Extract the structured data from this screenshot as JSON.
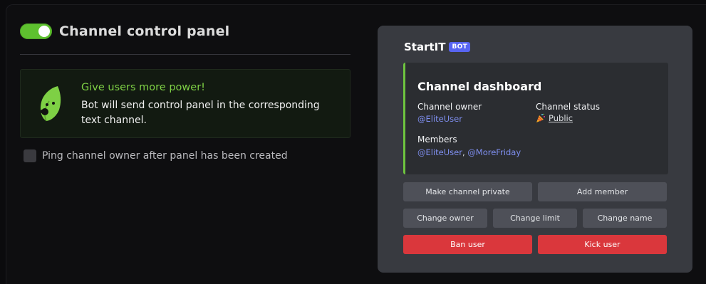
{
  "panel": {
    "title": "Channel control panel",
    "toggle_enabled": true,
    "info": {
      "heading": "Give users more power!",
      "text": "Bot will send control panel in the corresponding text channel."
    },
    "ping_label": "Ping channel owner after panel has been created",
    "ping_checked": false
  },
  "preview": {
    "bot_name": "StartIT",
    "bot_badge": "BOT",
    "embed": {
      "title": "Channel dashboard",
      "owner_label": "Channel owner",
      "owner_value": "@EliteUser",
      "status_label": "Channel status",
      "status_icon": "party-popper-icon",
      "status_value": "Public",
      "members_label": "Members",
      "members": [
        "@EliteUser",
        "@MoreFriday"
      ],
      "members_separator": ", "
    },
    "buttons": {
      "make_private": "Make channel private",
      "add_member": "Add member",
      "change_owner": "Change owner",
      "change_limit": "Change limit",
      "change_name": "Change name",
      "ban_user": "Ban user",
      "kick_user": "Kick user"
    }
  },
  "colors": {
    "accent_green": "#5ec12f",
    "heading_green": "#7ed045",
    "embed_border": "#6ec43f",
    "danger": "#da373c",
    "badge": "#5865f2",
    "mention": "#7f8ff0"
  }
}
